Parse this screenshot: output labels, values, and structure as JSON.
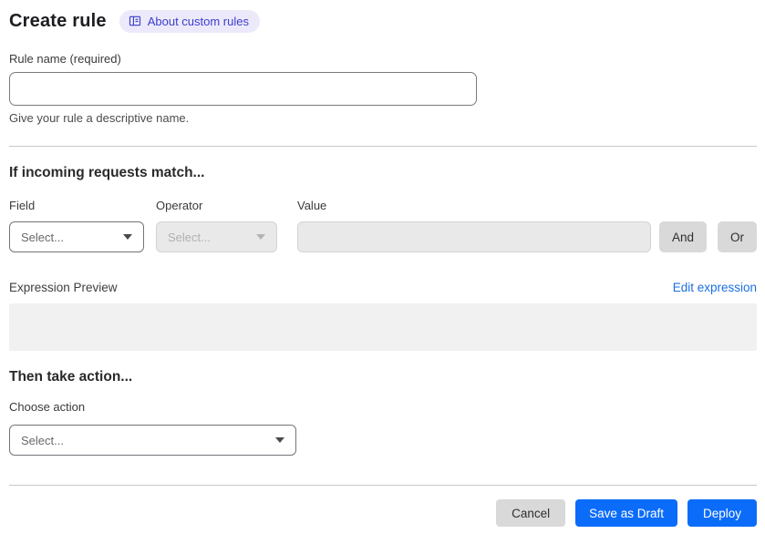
{
  "page": {
    "title": "Create rule",
    "about_label": "About custom rules"
  },
  "rule_name": {
    "label": "Rule name (required)",
    "value": "",
    "helper": "Give your rule a descriptive name."
  },
  "match": {
    "heading": "If incoming requests match...",
    "field_label": "Field",
    "field_value": "Select...",
    "operator_label": "Operator",
    "operator_value": "Select...",
    "value_label": "Value",
    "value_value": "",
    "and_label": "And",
    "or_label": "Or"
  },
  "expression": {
    "label": "Expression Preview",
    "edit_label": "Edit expression",
    "preview_value": ""
  },
  "action": {
    "heading": "Then take action...",
    "choose_label": "Choose action",
    "value": "Select..."
  },
  "footer": {
    "cancel_label": "Cancel",
    "save_label": "Save as Draft",
    "deploy_label": "Deploy"
  },
  "colors": {
    "primary_blue": "#0b6cfa",
    "link_blue": "#1b6fe0",
    "badge_bg": "#eceafa",
    "badge_text": "#3d3ccd",
    "button_gray": "#d9d9d9",
    "disabled_bg": "#e9e9e9",
    "preview_bg": "#f1f1f1"
  }
}
